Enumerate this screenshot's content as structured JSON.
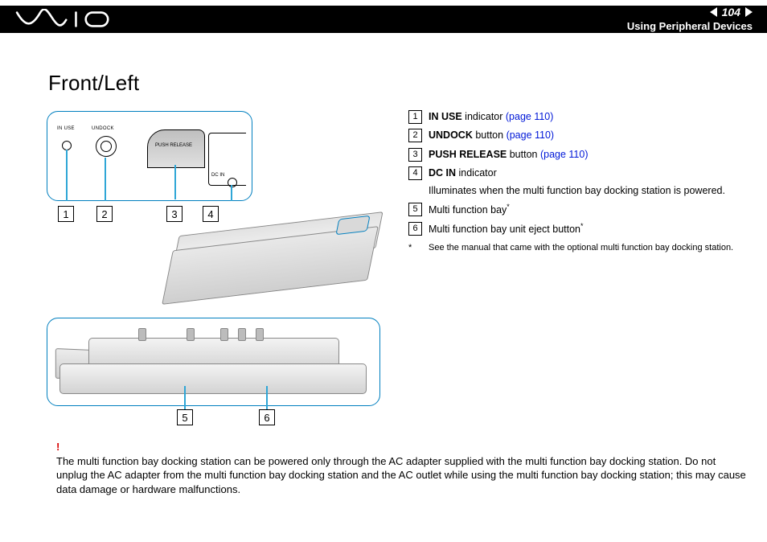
{
  "header": {
    "brand": "VAIO",
    "page_number": "104",
    "section_title": "Using Peripheral Devices"
  },
  "heading": "Front/Left",
  "top_panel_labels": {
    "in_use": "IN USE",
    "undock": "UNDOCK",
    "push_release": "PUSH RELEASE",
    "dc_in": "DC IN"
  },
  "callouts": {
    "row1": [
      "1",
      "2",
      "3",
      "4"
    ],
    "row2": [
      "5",
      "6"
    ]
  },
  "legend": {
    "items": [
      {
        "num": "1",
        "bold": "IN USE",
        "rest": " indicator ",
        "link": "(page 110)"
      },
      {
        "num": "2",
        "bold": "UNDOCK",
        "rest": " button ",
        "link": "(page 110)"
      },
      {
        "num": "3",
        "bold": "PUSH RELEASE",
        "rest": " button ",
        "link": "(page 110)"
      },
      {
        "num": "4",
        "bold": "DC IN",
        "rest": " indicator",
        "link": "",
        "sub": "Illuminates when the multi function bay docking station is powered."
      },
      {
        "num": "5",
        "bold": "",
        "rest": "Multi function bay",
        "link": "",
        "sup": "*"
      },
      {
        "num": "6",
        "bold": "",
        "rest": "Multi function bay unit eject button",
        "link": "",
        "sup": "*"
      }
    ],
    "footnote_mark": "*",
    "footnote": "See the manual that came with the optional multi function bay docking station."
  },
  "warning": {
    "bang": "!",
    "text": "The multi function bay docking station can be powered only through the AC adapter supplied with the multi function bay docking station. Do not unplug the AC adapter from the multi function bay docking station and the AC outlet while using the multi function bay docking station; this may cause data damage or hardware malfunctions."
  }
}
